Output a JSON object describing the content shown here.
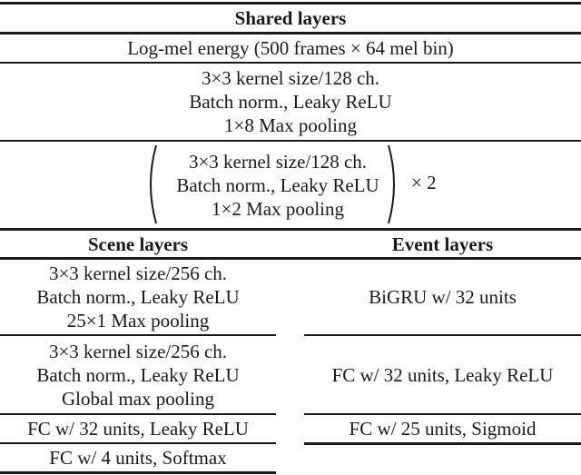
{
  "table": {
    "shared_header": "Shared layers",
    "input_row": "Log-mel energy (500 frames × 64 mel bin)",
    "conv_block_1": [
      "3×3 kernel size/128 ch.",
      "Batch norm., Leaky ReLU",
      "1×8 Max pooling"
    ],
    "conv_block_2": [
      "3×3 kernel size/128 ch.",
      "Batch norm., Leaky ReLU",
      "1×2 Max pooling"
    ],
    "conv_block_2_repeat": "× 2",
    "scene_header": "Scene layers",
    "event_header": "Event layers",
    "scene_rows": [
      [
        "3×3 kernel size/256 ch.",
        "Batch norm., Leaky ReLU",
        "25×1 Max pooling"
      ],
      [
        "3×3 kernel size/256 ch.",
        "Batch norm., Leaky ReLU",
        "Global max pooling"
      ],
      [
        "FC w/ 32 units, Leaky ReLU"
      ],
      [
        "FC w/ 4 units, Softmax"
      ]
    ],
    "event_rows": [
      [
        "BiGRU w/ 32 units"
      ],
      [
        "FC w/ 32 units, Leaky ReLU"
      ],
      [
        "FC w/ 25 units, Sigmoid"
      ]
    ]
  }
}
